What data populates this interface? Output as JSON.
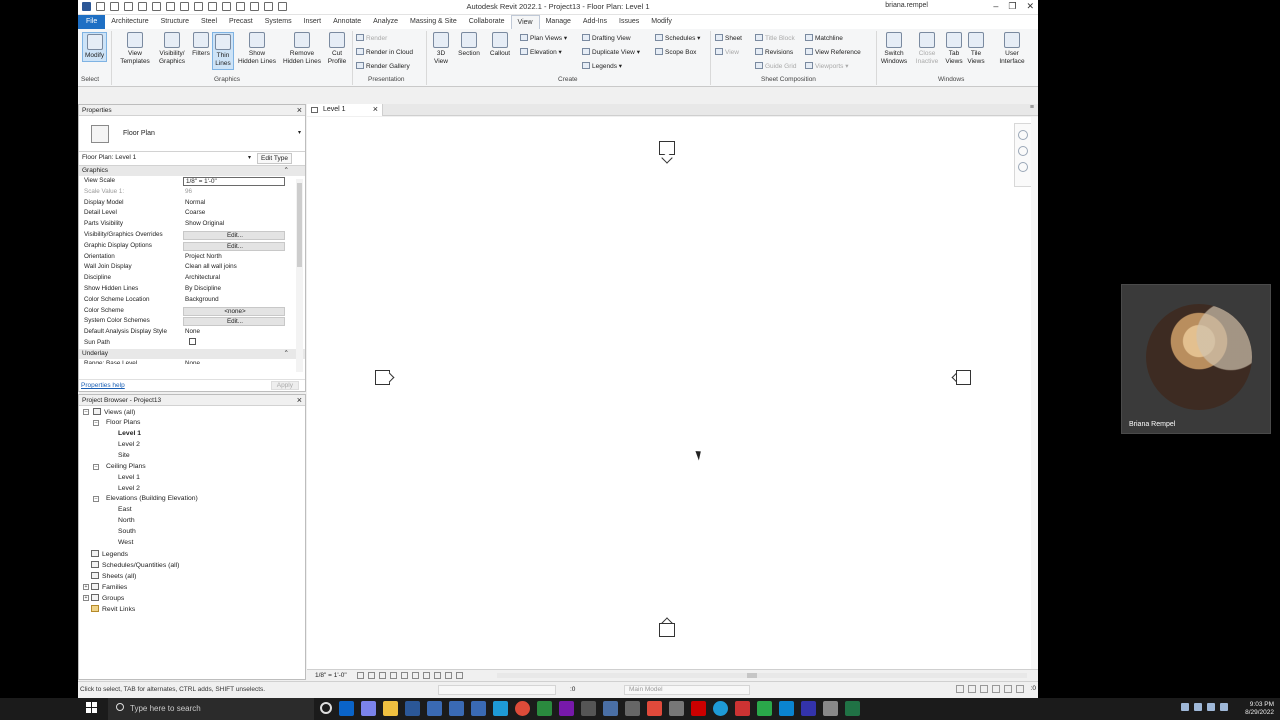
{
  "window": {
    "title": "Autodesk Revit 2022.1 - Project13 - Floor Plan: Level 1",
    "user": "briana.rempel"
  },
  "ribbon_tabs": [
    "File",
    "Architecture",
    "Structure",
    "Steel",
    "Precast",
    "Systems",
    "Insert",
    "Annotate",
    "Analyze",
    "Massing & Site",
    "Collaborate",
    "View",
    "Manage",
    "Add-Ins",
    "Issues",
    "Modify"
  ],
  "ribbon": {
    "modify": "Modify",
    "select": "Select",
    "view_templates": "View Templates",
    "visibility_graphics": "Visibility/ Graphics",
    "filters": "Filters",
    "thin_lines": "Thin Lines",
    "show_hidden_lines": "Show Hidden Lines",
    "remove_hidden_lines": "Remove Hidden Lines",
    "cut_profile": "Cut Profile",
    "graphics_label": "Graphics",
    "render": "Render",
    "render_in_cloud": "Render in Cloud",
    "render_gallery": "Render Gallery",
    "presentation_label": "Presentation",
    "three_d_view": "3D View",
    "section": "Section",
    "callout": "Callout",
    "plan_views": "Plan Views",
    "elevation": "Elevation",
    "drafting_view": "Drafting View",
    "duplicate_view": "Duplicate View",
    "legends": "Legends",
    "schedules": "Schedules",
    "scope_box": "Scope Box",
    "create_label": "Create",
    "sheet": "Sheet",
    "view": "View",
    "title_block": "Title Block",
    "revisions": "Revisions",
    "guide_grid": "Guide Grid",
    "matchline": "Matchline",
    "view_reference": "View Reference",
    "viewports": "Viewports",
    "sheet_composition_label": "Sheet Composition",
    "switch_windows": "Switch Windows",
    "close_inactive": "Close Inactive",
    "tab_views": "Tab Views",
    "tile_views": "Tile Views",
    "user_interface": "User Interface",
    "windows_label": "Windows"
  },
  "properties": {
    "header": "Properties",
    "type_name": "Floor Plan",
    "instance": "Floor Plan: Level 1",
    "edit_type": "Edit Type",
    "groups": [
      {
        "name": "Graphics",
        "rows": [
          {
            "k": "View Scale",
            "v": "1/8\" = 1'-0\""
          },
          {
            "k": "Scale Value    1:",
            "v": "96"
          },
          {
            "k": "Display Model",
            "v": "Normal"
          },
          {
            "k": "Detail Level",
            "v": "Coarse"
          },
          {
            "k": "Parts Visibility",
            "v": "Show Original"
          },
          {
            "k": "Visibility/Graphics Overrides",
            "v": "Edit..."
          },
          {
            "k": "Graphic Display Options",
            "v": "Edit..."
          },
          {
            "k": "Orientation",
            "v": "Project North"
          },
          {
            "k": "Wall Join Display",
            "v": "Clean all wall joins"
          },
          {
            "k": "Discipline",
            "v": "Architectural"
          },
          {
            "k": "Show Hidden Lines",
            "v": "By Discipline"
          },
          {
            "k": "Color Scheme Location",
            "v": "Background"
          },
          {
            "k": "Color Scheme",
            "v": "<none>"
          },
          {
            "k": "System Color Schemes",
            "v": "Edit..."
          },
          {
            "k": "Default Analysis Display Style",
            "v": "None"
          },
          {
            "k": "Sun Path",
            "v": ""
          }
        ]
      },
      {
        "name": "Underlay",
        "rows": [
          {
            "k": "Range: Base Level",
            "v": "None"
          }
        ]
      }
    ],
    "help": "Properties help",
    "apply": "Apply"
  },
  "browser": {
    "header": "Project Browser - Project13",
    "root": "Views (all)",
    "floor_plans": "Floor Plans",
    "fp_level1": "Level 1",
    "fp_level2": "Level 2",
    "fp_site": "Site",
    "ceiling_plans": "Ceiling Plans",
    "cp_level1": "Level 1",
    "cp_level2": "Level 2",
    "elevations": "Elevations (Building Elevation)",
    "east": "East",
    "north": "North",
    "south": "South",
    "west": "West",
    "legends": "Legends",
    "schedules": "Schedules/Quantities (all)",
    "sheets": "Sheets (all)",
    "families": "Families",
    "groups": "Groups",
    "revit_links": "Revit Links"
  },
  "view_tab": {
    "label": "Level 1"
  },
  "view_control": {
    "scale": "1/8\" = 1'-0\""
  },
  "status": {
    "message": "Click to select, TAB for alternates, CTRL adds, SHIFT unselects.",
    "zero": ":0",
    "model": "Main Model",
    "filter": ":0"
  },
  "webcam": {
    "name": "Briana Rempel"
  },
  "taskbar": {
    "search_placeholder": "Type here to search",
    "time": "9:03 PM",
    "date": "8/29/2022"
  }
}
